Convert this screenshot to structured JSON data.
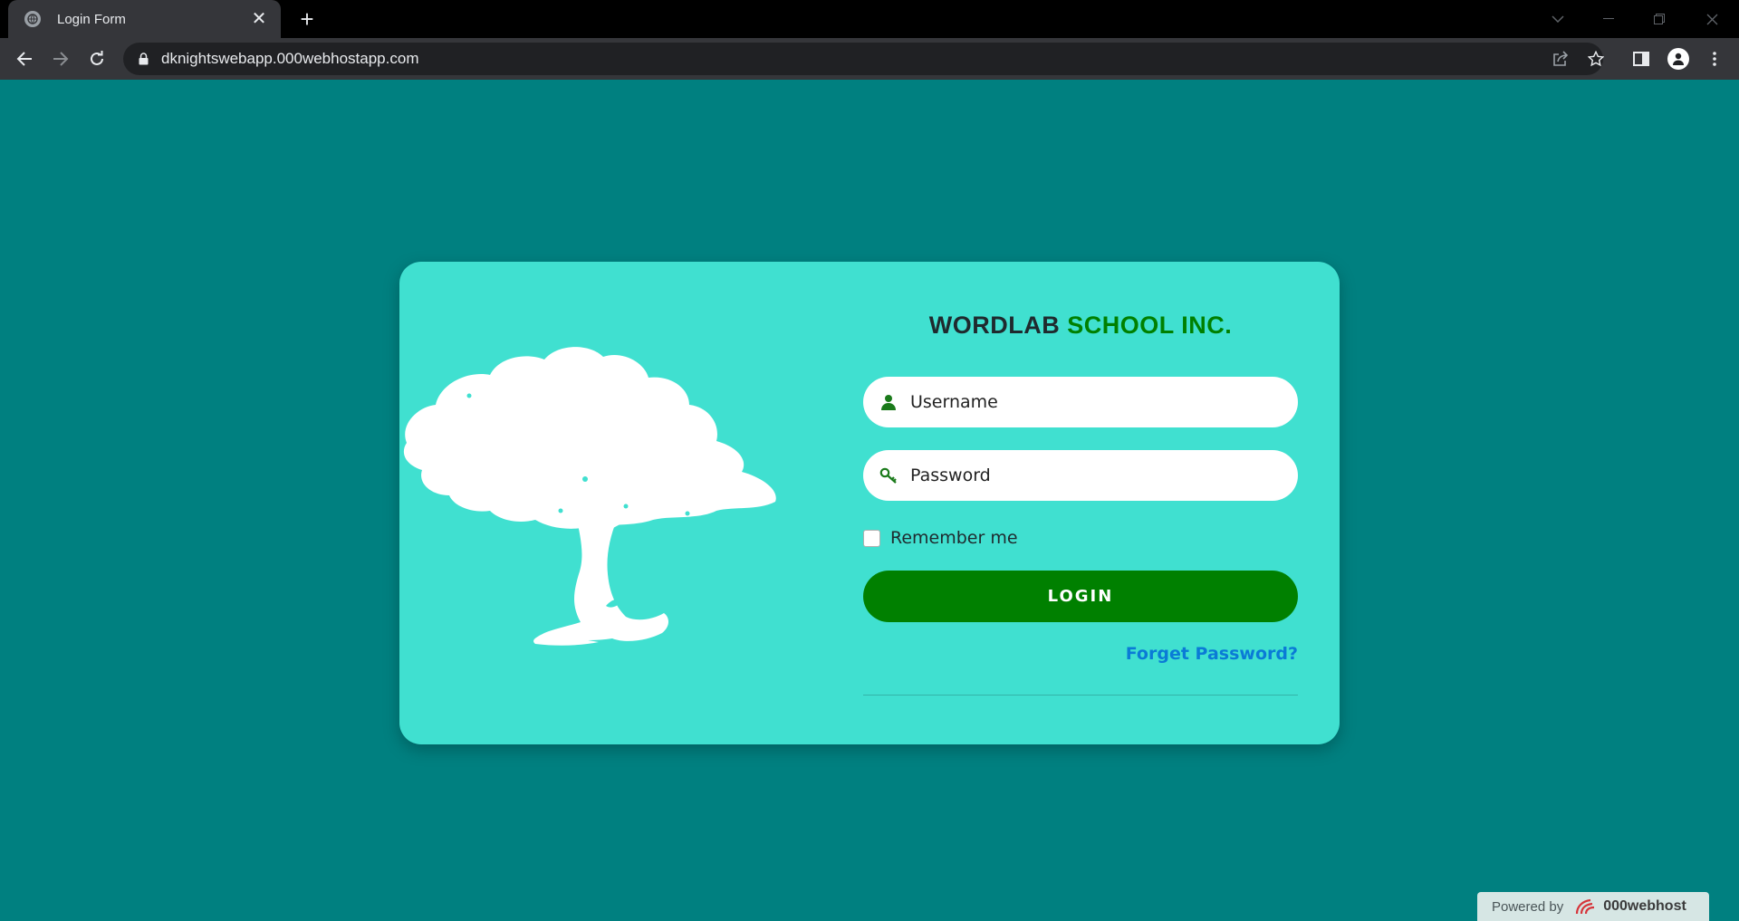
{
  "browser": {
    "tab_title": "Login Form",
    "tab_close": "✕",
    "new_tab": "+",
    "url": "dknightswebapp.000webhostapp.com"
  },
  "page": {
    "brand_part1": "WORDLAB",
    "brand_part2": "SCHOOL INC.",
    "username_placeholder": "Username",
    "password_placeholder": "Password",
    "remember_label": "Remember me",
    "remember_checked": false,
    "login_label": "LOGIN",
    "forgot_label": "Forget Password?"
  },
  "footer": {
    "powered_by": "Powered by",
    "host_name": "000webhost"
  },
  "colors": {
    "page_bg": "#008080",
    "card_bg": "#40e0d0",
    "accent_green": "#008000",
    "link_blue": "#0a7bd6"
  },
  "icons": {
    "username": "user-icon",
    "password": "key-icon",
    "tree": "tree-illustration"
  }
}
